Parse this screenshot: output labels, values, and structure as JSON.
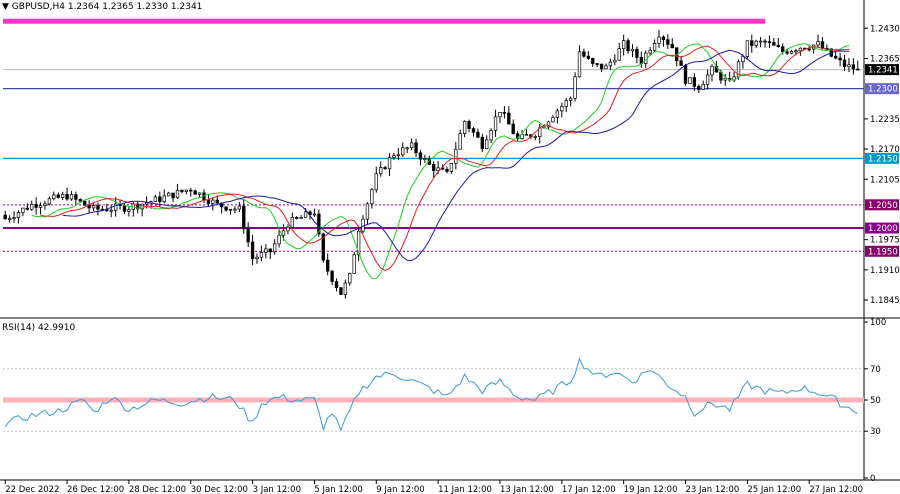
{
  "header": {
    "symbol": "GBPUSD,H4",
    "ohlc": "1.2364 1.2365 1.2330 1.2341"
  },
  "rsi_header": {
    "label": "RSI(14) 42.9910"
  },
  "colors": {
    "bg": "#ffffff",
    "candle": "#000000",
    "ma_fast": "#22cc22",
    "ma_mid": "#dd2222",
    "ma_slow": "#1a1aaa",
    "rsi": "#3a9ad9",
    "resistance": "#ff33cc",
    "level_blue": "#0099cc",
    "level_purple": "#4444aa",
    "level_magenta": "#880088",
    "rsi_band": "#ffb0b8"
  },
  "chart_data": [
    {
      "type": "candlestick",
      "price_range": [
        1.1815,
        1.2465
      ],
      "y_ticks": [
        "1.2430",
        "1.2365",
        "1.2235",
        "1.2170",
        "1.2105",
        "1.1975",
        "1.1910",
        "1.1845"
      ],
      "x_ticks": [
        {
          "i": 0,
          "label": "22 Dec 2022"
        },
        {
          "i": 14,
          "label": "26 Dec 12:00"
        },
        {
          "i": 28,
          "label": "28 Dec 12:00"
        },
        {
          "i": 42,
          "label": "30 Dec 12:00"
        },
        {
          "i": 56,
          "label": "3 Jan 12:00"
        },
        {
          "i": 70,
          "label": "5 Jan 12:00"
        },
        {
          "i": 84,
          "label": "9 Jan 12:00"
        },
        {
          "i": 98,
          "label": "11 Jan 12:00"
        },
        {
          "i": 112,
          "label": "13 Jan 12:00"
        },
        {
          "i": 126,
          "label": "17 Jan 12:00"
        },
        {
          "i": 140,
          "label": "19 Jan 12:00"
        },
        {
          "i": 154,
          "label": "23 Jan 12:00"
        },
        {
          "i": 168,
          "label": "25 Jan 12:00"
        },
        {
          "i": 182,
          "label": "27 Jan 12:00"
        }
      ],
      "key_closes": [
        [
          0,
          1.202
        ],
        [
          6,
          1.205
        ],
        [
          14,
          1.207
        ],
        [
          20,
          1.204
        ],
        [
          28,
          1.2045
        ],
        [
          34,
          1.206
        ],
        [
          42,
          1.2085
        ],
        [
          48,
          1.205
        ],
        [
          53,
          1.204
        ],
        [
          56,
          1.1935
        ],
        [
          60,
          1.195
        ],
        [
          64,
          1.201
        ],
        [
          70,
          1.2035
        ],
        [
          72,
          1.1925
        ],
        [
          76,
          1.186
        ],
        [
          78,
          1.1895
        ],
        [
          80,
          1.2
        ],
        [
          84,
          1.211
        ],
        [
          88,
          1.216
        ],
        [
          92,
          1.2175
        ],
        [
          96,
          1.2135
        ],
        [
          100,
          1.2115
        ],
        [
          104,
          1.223
        ],
        [
          108,
          1.218
        ],
        [
          112,
          1.2255
        ],
        [
          116,
          1.219
        ],
        [
          120,
          1.2205
        ],
        [
          124,
          1.2245
        ],
        [
          128,
          1.228
        ],
        [
          130,
          1.238
        ],
        [
          133,
          1.235
        ],
        [
          136,
          1.2345
        ],
        [
          140,
          1.2395
        ],
        [
          144,
          1.236
        ],
        [
          148,
          1.242
        ],
        [
          151,
          1.239
        ],
        [
          154,
          1.232
        ],
        [
          157,
          1.2305
        ],
        [
          160,
          1.234
        ],
        [
          164,
          1.231
        ],
        [
          168,
          1.2395
        ],
        [
          172,
          1.24
        ],
        [
          176,
          1.238
        ],
        [
          180,
          1.239
        ],
        [
          184,
          1.2395
        ],
        [
          187,
          1.237
        ],
        [
          190,
          1.235
        ],
        [
          193,
          1.2341
        ]
      ],
      "ma_tail": [
        {
          "offset": 6,
          "value": 1.2371
        },
        {
          "offset": 13,
          "value": 1.2374
        }
      ],
      "levels": [
        {
          "price": 1.23,
          "label": "1.2300",
          "kind": "solid",
          "color_key": "level_purple",
          "tag": true,
          "tag_bg": "#6666cc"
        },
        {
          "price": 1.215,
          "label": "1.2150",
          "kind": "solid",
          "color_key": "level_blue",
          "tag": true,
          "tag_bg": "#0099cc"
        },
        {
          "price": 1.205,
          "label": "1.2050",
          "kind": "dashed",
          "color_key": "level_magenta",
          "tag": true,
          "tag_bg": "#880066"
        },
        {
          "price": 1.2,
          "label": "1.2000",
          "kind": "thick",
          "color_key": "level_magenta",
          "tag": true,
          "tag_bg": "#880088"
        },
        {
          "price": 1.195,
          "label": "1.1950",
          "kind": "dashed",
          "color_key": "level_magenta",
          "tag": true,
          "tag_bg": "#880066"
        }
      ],
      "resistance": {
        "price": 1.2445,
        "from_i": 0,
        "to_i": 172
      },
      "current": {
        "price": 1.2341,
        "label": "1.2341"
      }
    },
    {
      "type": "line",
      "name": "RSI(14)",
      "range": [
        0,
        100
      ],
      "y_ticks": [
        "100",
        "70",
        "50",
        "30",
        "0"
      ],
      "band": 50,
      "key_values": [
        [
          0,
          35
        ],
        [
          6,
          40
        ],
        [
          12,
          43
        ],
        [
          18,
          50
        ],
        [
          20,
          42
        ],
        [
          24,
          52
        ],
        [
          28,
          44
        ],
        [
          34,
          50
        ],
        [
          40,
          48
        ],
        [
          46,
          52
        ],
        [
          52,
          50
        ],
        [
          56,
          35
        ],
        [
          58,
          48
        ],
        [
          62,
          52
        ],
        [
          66,
          50
        ],
        [
          70,
          50
        ],
        [
          72,
          33
        ],
        [
          74,
          42
        ],
        [
          76,
          30
        ],
        [
          80,
          55
        ],
        [
          84,
          65
        ],
        [
          88,
          67
        ],
        [
          94,
          60
        ],
        [
          100,
          52
        ],
        [
          104,
          65
        ],
        [
          108,
          56
        ],
        [
          112,
          62
        ],
        [
          116,
          52
        ],
        [
          120,
          50
        ],
        [
          124,
          56
        ],
        [
          128,
          63
        ],
        [
          130,
          75
        ],
        [
          134,
          65
        ],
        [
          138,
          68
        ],
        [
          142,
          62
        ],
        [
          146,
          70
        ],
        [
          150,
          60
        ],
        [
          154,
          52
        ],
        [
          156,
          42
        ],
        [
          160,
          48
        ],
        [
          164,
          44
        ],
        [
          168,
          60
        ],
        [
          172,
          56
        ],
        [
          176,
          54
        ],
        [
          180,
          58
        ],
        [
          184,
          55
        ],
        [
          188,
          50
        ],
        [
          190,
          46
        ],
        [
          193,
          43
        ]
      ]
    }
  ]
}
